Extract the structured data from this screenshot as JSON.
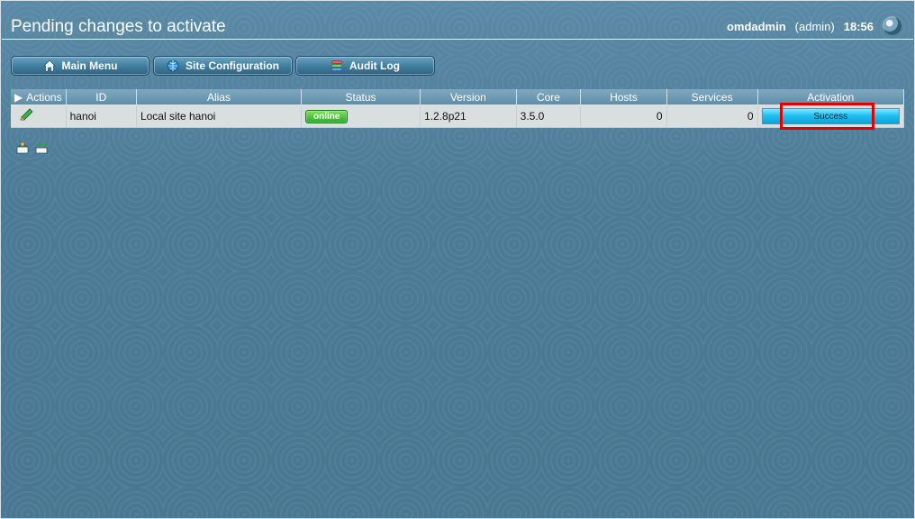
{
  "header": {
    "title": "Pending changes to activate",
    "user": "omdadmin",
    "role": "(admin)",
    "time": "18:56"
  },
  "buttons": [
    {
      "label": "Main Menu",
      "icon": "home-icon"
    },
    {
      "label": "Site Configuration",
      "icon": "globe-icon"
    },
    {
      "label": "Audit Log",
      "icon": "log-stack-icon"
    }
  ],
  "table": {
    "headers": [
      "Actions",
      "ID",
      "Alias",
      "Status",
      "Version",
      "Core",
      "Hosts",
      "Services",
      "Activation"
    ],
    "row": {
      "id": "hanoi",
      "alias": "Local site hanoi",
      "status": "online",
      "version": "1.2.8p21",
      "core": "3.5.0",
      "hosts": "0",
      "services": "0",
      "activation": "Success"
    }
  },
  "colors": {
    "highlight": "#e00000",
    "online": "#2fa62f",
    "activation": "#1fc0f2"
  }
}
